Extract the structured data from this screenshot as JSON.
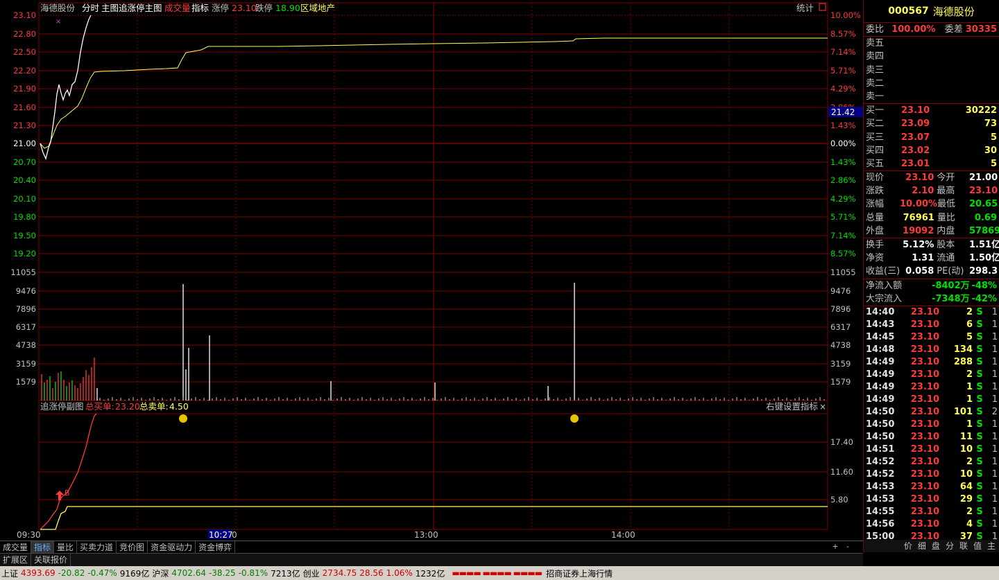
{
  "header": {
    "stock_name": "海德股份",
    "mode": "分时",
    "main_chart": "主图追涨停主图",
    "volume_label": "成交量",
    "indicator_label": "指标",
    "limit_up_label": "涨停",
    "limit_up": "23.10",
    "limit_down_label": "跌停",
    "limit_down": "18.90",
    "sector": "区域地产",
    "stats_button": "统计"
  },
  "price_axis": {
    "left": [
      "23.10",
      "22.80",
      "22.50",
      "22.20",
      "21.90",
      "21.60",
      "21.30",
      "21.00",
      "20.70",
      "20.40",
      "20.10",
      "19.80",
      "19.50",
      "19.20"
    ],
    "right": [
      "10.00%",
      "8.57%",
      "7.14%",
      "5.71%",
      "4.29%",
      "2.86%",
      "1.43%",
      "0.00%",
      "1.43%",
      "2.86%",
      "4.29%",
      "5.71%",
      "7.14%",
      "8.57%"
    ],
    "crosshair_value": "21.42"
  },
  "volume_axis": [
    "11055",
    "9476",
    "7896",
    "6317",
    "4738",
    "3159",
    "1579"
  ],
  "sub_chart": {
    "title": "追涨停副图",
    "buy_label": "总买单:",
    "buy_value": "23.20",
    "sell_label": "总卖单:",
    "sell_value": "4.50",
    "settings": "右键设置指标",
    "axis": [
      "17.40",
      "11.60",
      "5.80"
    ],
    "buy_marker": "B"
  },
  "time_axis": {
    "labels": [
      "09:30",
      "13:00",
      "14:00"
    ],
    "crosshair_time": "10:27",
    "crosshair_suffix": "0"
  },
  "panel": {
    "code": "000567",
    "name": "海德股份",
    "ratio_label": "委比",
    "ratio": "100.00%",
    "diff_label": "委差",
    "diff": "30335",
    "asks": [
      {
        "label": "卖五"
      },
      {
        "label": "卖四"
      },
      {
        "label": "卖三"
      },
      {
        "label": "卖二"
      },
      {
        "label": "卖一"
      }
    ],
    "bids": [
      {
        "label": "买一",
        "price": "23.10",
        "vol": "30222"
      },
      {
        "label": "买二",
        "price": "23.09",
        "vol": "73"
      },
      {
        "label": "买三",
        "price": "23.07",
        "vol": "5"
      },
      {
        "label": "买四",
        "price": "23.02",
        "vol": "30"
      },
      {
        "label": "买五",
        "price": "23.01",
        "vol": "5"
      }
    ],
    "quote": [
      {
        "l1": "现价",
        "v1": "23.10",
        "l2": "今开",
        "v2": "21.00"
      },
      {
        "l1": "涨跌",
        "v1": "2.10",
        "l2": "最高",
        "v2": "23.10"
      },
      {
        "l1": "涨幅",
        "v1": "10.00%",
        "l2": "最低",
        "v2": "20.65"
      },
      {
        "l1": "总量",
        "v1": "76961",
        "l2": "量比",
        "v2": "0.69"
      },
      {
        "l1": "外盘",
        "v1": "19092",
        "l2": "内盘",
        "v2": "57869"
      }
    ],
    "fundamentals": [
      {
        "l1": "换手",
        "v1": "5.12%",
        "l2": "股本",
        "v2": "1.51亿"
      },
      {
        "l1": "净资",
        "v1": "1.31",
        "l2": "流通",
        "v2": "1.50亿"
      },
      {
        "l1": "收益(三)",
        "v1": "0.058",
        "l2": "PE(动)",
        "v2": "298.3"
      }
    ],
    "flows": [
      {
        "label": "净流入额",
        "value": "-8402万",
        "pct": "-48%"
      },
      {
        "label": "大宗流入",
        "value": "-7348万",
        "pct": "-42%"
      }
    ],
    "ticks": [
      {
        "t": "14:40",
        "p": "23.10",
        "v": "2",
        "s": "S",
        "n": "1"
      },
      {
        "t": "14:43",
        "p": "23.10",
        "v": "6",
        "s": "S",
        "n": "1"
      },
      {
        "t": "14:45",
        "p": "23.10",
        "v": "5",
        "s": "S",
        "n": "1"
      },
      {
        "t": "14:48",
        "p": "23.10",
        "v": "134",
        "s": "S",
        "n": "1"
      },
      {
        "t": "14:49",
        "p": "23.10",
        "v": "288",
        "s": "S",
        "n": "1"
      },
      {
        "t": "14:49",
        "p": "23.10",
        "v": "2",
        "s": "S",
        "n": "1"
      },
      {
        "t": "14:49",
        "p": "23.10",
        "v": "1",
        "s": "S",
        "n": "1"
      },
      {
        "t": "14:49",
        "p": "23.10",
        "v": "1",
        "s": "S",
        "n": "1"
      },
      {
        "t": "14:50",
        "p": "23.10",
        "v": "101",
        "s": "S",
        "n": "2"
      },
      {
        "t": "14:50",
        "p": "23.10",
        "v": "1",
        "s": "S",
        "n": "1"
      },
      {
        "t": "14:50",
        "p": "23.10",
        "v": "11",
        "s": "S",
        "n": "1"
      },
      {
        "t": "14:51",
        "p": "23.10",
        "v": "10",
        "s": "S",
        "n": "1"
      },
      {
        "t": "14:52",
        "p": "23.10",
        "v": "2",
        "s": "S",
        "n": "1"
      },
      {
        "t": "14:52",
        "p": "23.10",
        "v": "10",
        "s": "S",
        "n": "1"
      },
      {
        "t": "14:53",
        "p": "23.10",
        "v": "64",
        "s": "S",
        "n": "1"
      },
      {
        "t": "14:53",
        "p": "23.10",
        "v": "29",
        "s": "S",
        "n": "1"
      },
      {
        "t": "14:55",
        "p": "23.10",
        "v": "2",
        "s": "S",
        "n": "1"
      },
      {
        "t": "14:56",
        "p": "23.10",
        "v": "4",
        "s": "S",
        "n": "1"
      },
      {
        "t": "15:00",
        "p": "23.10",
        "v": "37",
        "s": "S",
        "n": "1"
      }
    ],
    "bottom_tabs": [
      "价",
      "细",
      "盘",
      "分",
      "联",
      "值",
      "主"
    ]
  },
  "tabs": [
    "成交量",
    "指标",
    "量比",
    "买卖力道",
    "竞价图",
    "资金驱动力",
    "资金博弈"
  ],
  "tabs_active": "指标",
  "tabs2": [
    "扩展区",
    "关联报价"
  ],
  "status": {
    "sh_label": "上证",
    "sh_val": "4393.69",
    "sh_chg": "-20.82",
    "sh_pct": "-0.47%",
    "sh_amt": "9169亿",
    "sz_label": "沪深",
    "sz_val": "4702.64",
    "sz_chg": "-38.25",
    "sz_pct": "-0.81%",
    "sz_amt": "7213亿",
    "cy_label": "创业",
    "cy_val": "2734.75",
    "cy_chg": "28.56",
    "cy_pct": "1.06%",
    "cy_amt": "1232亿",
    "broker": "招商证券上海行情"
  },
  "colors": {
    "grid": "#800000",
    "price": "#ffffff",
    "avg": "#ffff55",
    "up": "#ff3a3a",
    "down": "#00e000"
  }
}
